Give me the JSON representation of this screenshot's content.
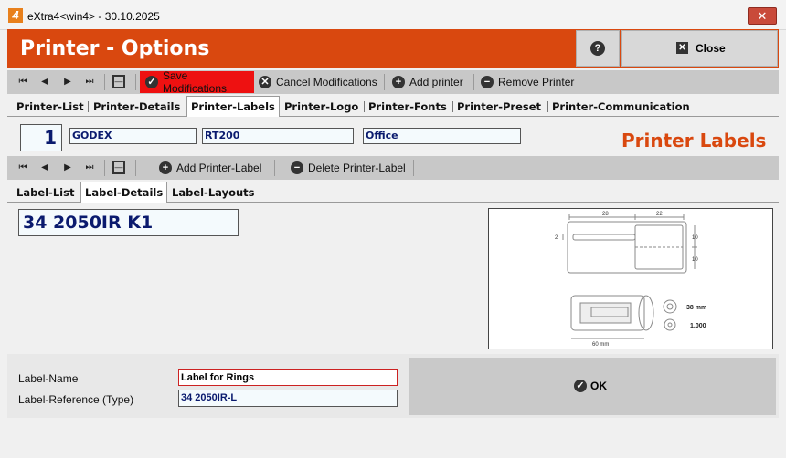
{
  "window": {
    "title": "eXtra4<win4>  -  30.10.2025",
    "logo": "4"
  },
  "header": {
    "title": "Printer - Options",
    "help_label": "?",
    "close_label": "Close"
  },
  "toolbar1": {
    "save_label": "Save Modifications",
    "cancel_label": "Cancel Modifications",
    "add_label": "Add printer",
    "remove_label": "Remove Printer"
  },
  "tabs1": [
    "Printer-List",
    "Printer-Details",
    "Printer-Labels",
    "Printer-Logo",
    "Printer-Fonts",
    "Printer-Preset",
    "Printer-Communication"
  ],
  "printer": {
    "number": "1",
    "brand": "GODEX",
    "model": "RT200",
    "location": "Office"
  },
  "section_title": "Printer Labels",
  "toolbar2": {
    "add_label": "Add Printer-Label",
    "delete_label": "Delete Printer-Label"
  },
  "tabs2": [
    "Label-List",
    "Label-Details",
    "Label-Layouts"
  ],
  "label": {
    "code": "34 2050IR K1",
    "name_label": "Label-Name",
    "name_value": "Label for Rings",
    "ref_label": "Label-Reference (Type)",
    "ref_value": "34 2050IR-L"
  },
  "preview": {
    "dim_top_left": "28",
    "dim_top_right": "22",
    "dim_left": "2",
    "dim_right_top": "10",
    "dim_right_bottom": "10",
    "roll_width": "60 mm",
    "core": "38 mm",
    "count": "1.000"
  },
  "ok_label": "OK",
  "colors": {
    "accent": "#d9480f",
    "save": "#ee1111",
    "field_text": "#0a1a6e"
  }
}
